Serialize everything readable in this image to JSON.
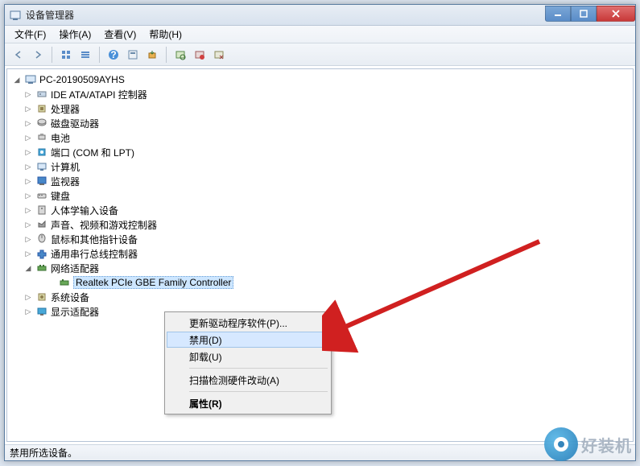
{
  "window": {
    "title": "设备管理器"
  },
  "menu": {
    "file": "文件(F)",
    "action": "操作(A)",
    "view": "查看(V)",
    "help": "帮助(H)"
  },
  "root": "PC-20190509AYHS",
  "categories": [
    "IDE ATA/ATAPI 控制器",
    "处理器",
    "磁盘驱动器",
    "电池",
    "端口 (COM 和 LPT)",
    "计算机",
    "监视器",
    "键盘",
    "人体学输入设备",
    "声音、视频和游戏控制器",
    "鼠标和其他指针设备",
    "通用串行总线控制器",
    "网络适配器",
    "系统设备",
    "显示适配器"
  ],
  "selected_device": "Realtek PCIe GBE Family Controller",
  "context_menu": {
    "update": "更新驱动程序软件(P)...",
    "disable": "禁用(D)",
    "uninstall": "卸载(U)",
    "scan": "扫描检测硬件改动(A)",
    "properties": "属性(R)"
  },
  "status": "禁用所选设备。",
  "watermark": "好装机"
}
